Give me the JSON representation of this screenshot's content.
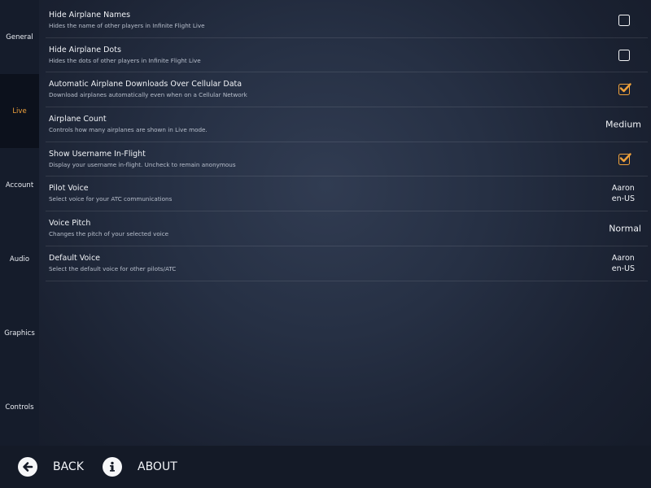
{
  "sidebar": {
    "items": [
      {
        "label": "General",
        "active": false
      },
      {
        "label": "Live",
        "active": true
      },
      {
        "label": "Account",
        "active": false
      },
      {
        "label": "Audio",
        "active": false
      },
      {
        "label": "Graphics",
        "active": false
      },
      {
        "label": "Controls",
        "active": false
      }
    ]
  },
  "settings": [
    {
      "title": "Hide Airplane Names",
      "subtitle": "Hides the name of other players in Infinite Flight Live",
      "type": "checkbox",
      "checked": false
    },
    {
      "title": "Hide Airplane Dots",
      "subtitle": "Hides the dots of other players in Infinite Flight Live",
      "type": "checkbox",
      "checked": false
    },
    {
      "title": "Automatic Airplane Downloads Over Cellular Data",
      "subtitle": "Download airplanes automatically even when on a Cellular Network",
      "type": "checkbox",
      "checked": true
    },
    {
      "title": "Airplane Count",
      "subtitle": "Controls how many airplanes are shown in Live mode.",
      "type": "value",
      "value": "Medium"
    },
    {
      "title": "Show Username In-Flight",
      "subtitle": "Display your username in-flight. Uncheck to remain anonymous",
      "type": "checkbox",
      "checked": true
    },
    {
      "title": "Pilot Voice",
      "subtitle": "Select voice for your ATC communications",
      "type": "value2",
      "value": "Aaron",
      "value2": "en-US"
    },
    {
      "title": "Voice Pitch",
      "subtitle": "Changes the pitch of your selected voice",
      "type": "value",
      "value": "Normal"
    },
    {
      "title": "Default Voice",
      "subtitle": "Select the default voice for other pilots/ATC",
      "type": "value2",
      "value": "Aaron",
      "value2": "en-US"
    }
  ],
  "bottom_bar": {
    "back_label": "BACK",
    "back_icon": "arrow-left-icon",
    "about_label": "ABOUT",
    "about_icon": "info-icon"
  },
  "colors": {
    "accent": "#f0a23c",
    "text": "#f1f3f7",
    "subtext": "#b8bfcc",
    "sidebar_bg": "#151c2b",
    "sidebar_active_bg": "#0c111c"
  }
}
